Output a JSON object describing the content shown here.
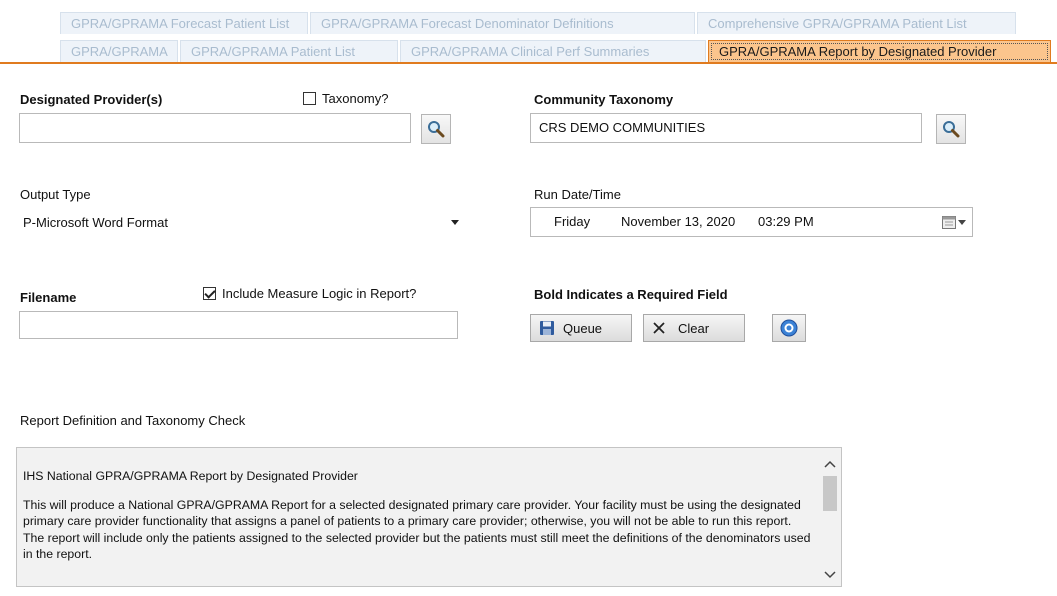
{
  "tabs_row1": [
    {
      "label": "GPRA/GPRAMA Forecast Patient List"
    },
    {
      "label": "GPRA/GPRAMA Forecast Denominator Definitions"
    },
    {
      "label": "Comprehensive GPRA/GPRAMA Patient List"
    }
  ],
  "tabs_row2": [
    {
      "label": "GPRA/GPRAMA"
    },
    {
      "label": "GPRA/GPRAMA Patient List"
    },
    {
      "label": "GPRA/GPRAMA Clinical Perf Summaries"
    },
    {
      "label": "GPRA/GPRAMA Report by Designated Provider"
    }
  ],
  "form": {
    "designated_provider_label": "Designated Provider(s)",
    "designated_provider_value": "",
    "taxonomy_label": "Taxonomy?",
    "taxonomy_checked": false,
    "community_taxonomy_label": "Community Taxonomy",
    "community_taxonomy_value": "CRS DEMO COMMUNITIES",
    "output_type_label": "Output Type",
    "output_type_value": "P-Microsoft Word Format",
    "run_datetime_label": "Run Date/Time",
    "run_day": "Friday",
    "run_date": "November 13, 2020",
    "run_time": "03:29 PM",
    "filename_label": "Filename",
    "filename_value": "",
    "include_logic_label": "Include Measure Logic in Report?",
    "include_logic_checked": true,
    "required_note": "Bold Indicates a Required Field",
    "queue_label": "Queue",
    "clear_label": "Clear",
    "report_section_label": "Report Definition and Taxonomy Check"
  },
  "report": {
    "title": "IHS National GPRA/GPRAMA Report by Designated Provider",
    "body": "This will produce a National GPRA/GPRAMA Report for a selected designated primary care provider.  Your facility must be using the designated primary care provider functionality that assigns a panel of patients to a primary care provider; otherwise, you will not be able to run this report.  The report will include only the patients assigned to the selected provider but the patients must still meet the definitions of the denominators used in the report."
  },
  "icons": {
    "search": "search-icon",
    "calendar": "calendar-icon",
    "save": "save-icon",
    "clear": "close-icon",
    "help": "help-icon"
  },
  "colors": {
    "active_tab_bg": "#fbc58d",
    "active_tab_border": "#e07b1f",
    "inactive_tab_text": "#a9bccf"
  }
}
